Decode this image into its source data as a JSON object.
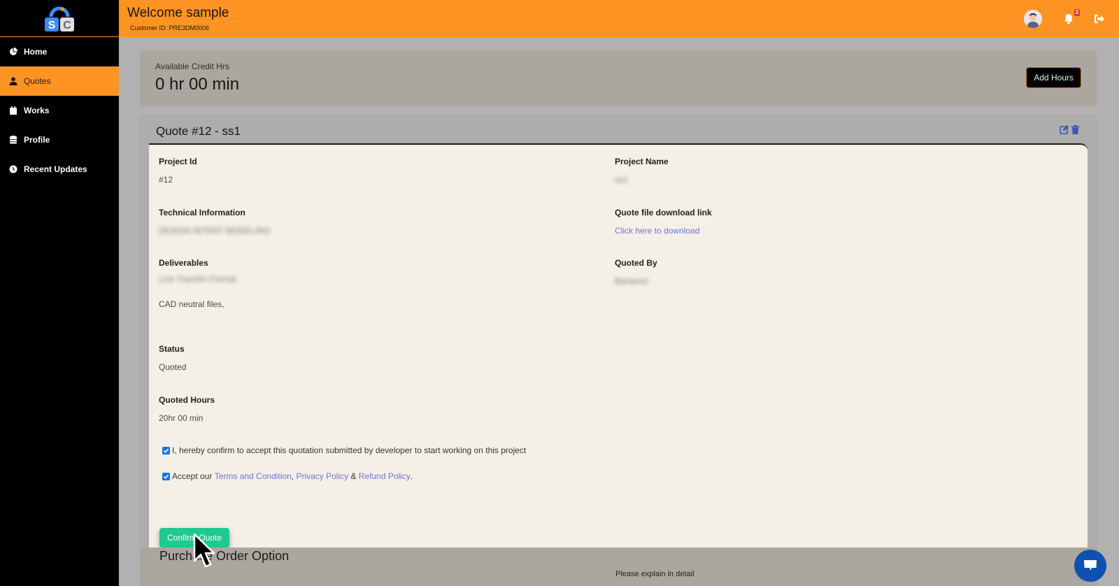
{
  "header": {
    "logo_letters": [
      "S",
      "C"
    ],
    "welcome": "Welcome sample",
    "customer_id": "Customer ID: PRE3DM0006",
    "notification_count": "3",
    "icons": [
      "avatar-icon",
      "bell-icon",
      "logout-icon"
    ]
  },
  "sidebar": {
    "items": [
      {
        "label": "Home",
        "icon": "pie-chart-icon",
        "active": false
      },
      {
        "label": "Quotes",
        "icon": "user-icon",
        "active": true
      },
      {
        "label": "Works",
        "icon": "calendar-icon",
        "active": false
      },
      {
        "label": "Profile",
        "icon": "database-icon",
        "active": false
      },
      {
        "label": "Recent Updates",
        "icon": "clock-icon",
        "active": false
      }
    ]
  },
  "credit": {
    "label": "Available Credit Hrs",
    "value": "0 hr 00 min",
    "add_hours_label": "Add Hours"
  },
  "quote": {
    "title": "Quote #12 - ss1",
    "fields": {
      "project_id": {
        "label": "Project Id",
        "value": "#12"
      },
      "project_name": {
        "label": "Project Name",
        "value": "ss1"
      },
      "technical_info": {
        "label": "Technical Information",
        "value": "DESIGN INTENT MODELING"
      },
      "download": {
        "label": "Quote file download link",
        "link_text": "Click here to download"
      },
      "deliverables": {
        "label": "Deliverables",
        "value": "Live Transfer Format",
        "extra": "CAD neutral files,"
      },
      "quoted_by": {
        "label": "Quoted By",
        "value": "Backend"
      },
      "status": {
        "label": "Status",
        "value": "Quoted"
      },
      "quoted_hours": {
        "label": "Quoted Hours",
        "value": "20hr 00 min"
      }
    },
    "confirm_checkbox": {
      "checked": true,
      "text": "I, hereby confirm to accept this quotation submitted by developer to start working on this project"
    },
    "terms_checkbox": {
      "checked": true,
      "prefix": "Accept our ",
      "terms": "Terms and Condition",
      "sep1": ", ",
      "privacy": "Privacy Policy",
      "sep2": " & ",
      "refund": "Refund Policy",
      "suffix": "."
    },
    "confirm_button": "Confirm Quote"
  },
  "purchase_order": {
    "title": "Purchase Order Option",
    "hint": "Please explain in detail"
  },
  "colors": {
    "brand_orange": "#fd9322",
    "confirm_green": "#1fc98f",
    "link_blue": "#6d73d6",
    "chat_blue": "#0f51b0"
  }
}
